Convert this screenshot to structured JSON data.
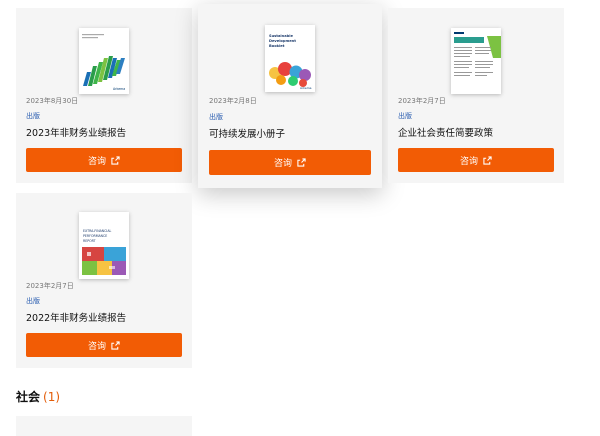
{
  "publications": [
    {
      "date": "2023年8月30日",
      "category": "出版",
      "title": "2023年非财务业绩报告",
      "button": "咨询"
    },
    {
      "date": "2023年2月8日",
      "category": "出版",
      "title": "可持续发展小册子",
      "button": "咨询",
      "cover_text": "Sustainable Development Booklet"
    },
    {
      "date": "2023年2月7日",
      "category": "出版",
      "title": "企业社会责任简要政策",
      "button": "咨询"
    },
    {
      "date": "2023年2月7日",
      "category": "出版",
      "title": "2022年非财务业绩报告",
      "button": "咨询",
      "cover_text": "EXTRA-FINANCIAL PERFORMANCE REPORT"
    }
  ],
  "social_section": {
    "title": "社会",
    "count": "(1)"
  },
  "colors": {
    "accent": "#f25c05",
    "link": "#2a5db0",
    "card_bg": "#f5f5f5"
  },
  "icons": {
    "external_link": "external-link-icon"
  }
}
